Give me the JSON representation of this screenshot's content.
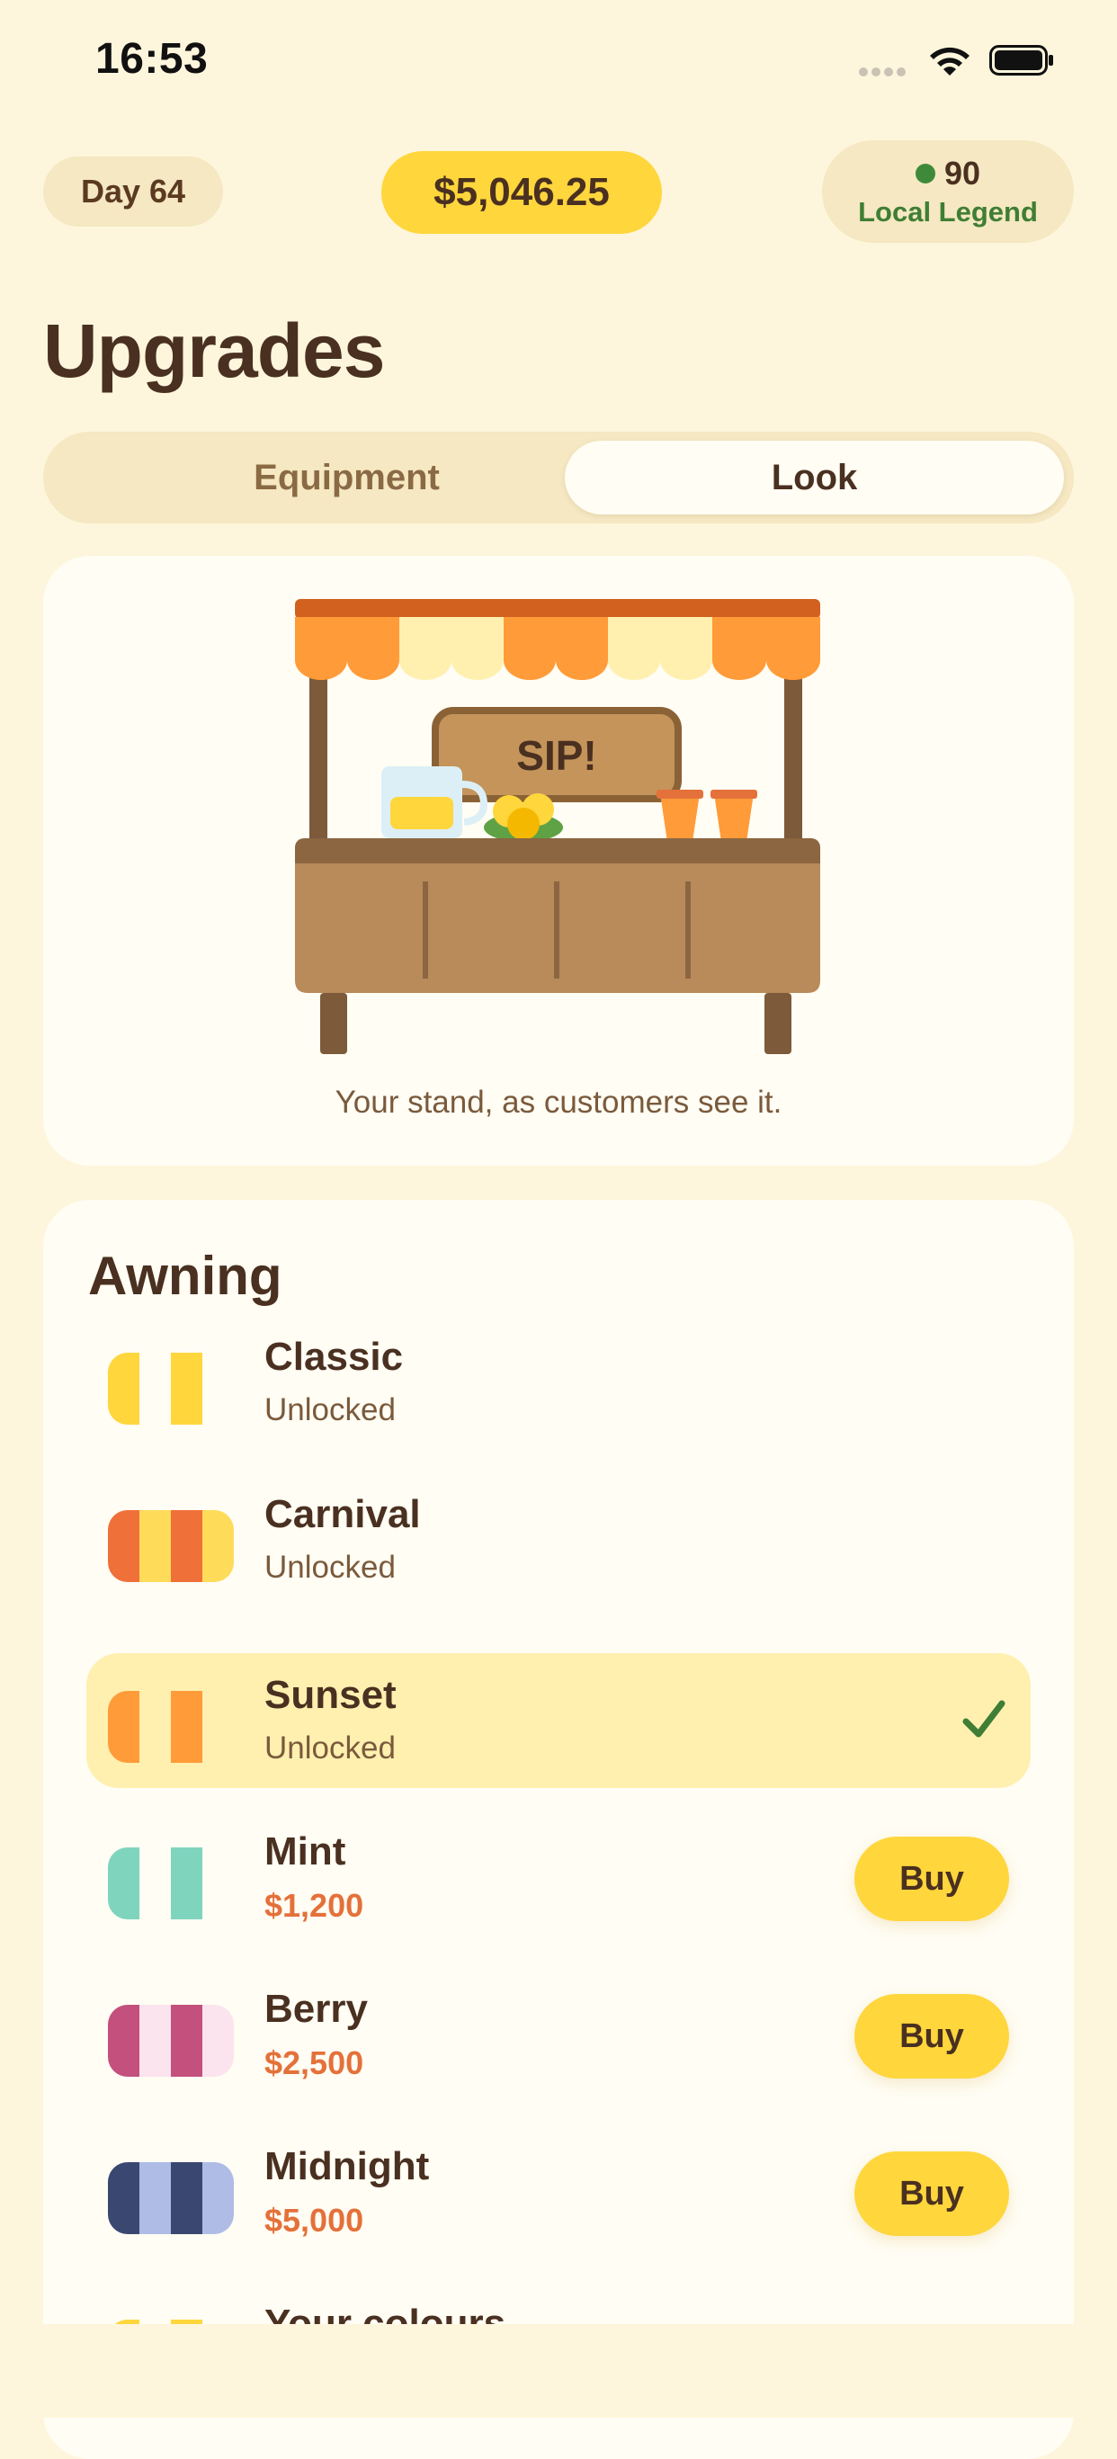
{
  "status_bar": {
    "time": "16:53"
  },
  "header": {
    "day": "Day 64",
    "balance": "$5,046.25",
    "reputation_score": "90",
    "reputation_label": "Local Legend",
    "reputation_color": "#3F8A3A"
  },
  "page_title": "Upgrades",
  "tabs": [
    {
      "label": "Equipment",
      "selected": false
    },
    {
      "label": "Look",
      "selected": true
    }
  ],
  "preview": {
    "sign_text": "SIP!",
    "caption": "Your stand, as customers see it."
  },
  "awning": {
    "section_title": "Awning",
    "items": [
      {
        "name": "Classic",
        "status": "Unlocked",
        "colors": [
          "#FFD63C",
          "#FFFDF4"
        ]
      },
      {
        "name": "Carnival",
        "status": "Unlocked",
        "colors": [
          "#F0703A",
          "#FFDB5A"
        ]
      },
      {
        "name": "Sunset",
        "status": "Unlocked",
        "selected": true,
        "colors": [
          "#FF9B38",
          "#FFF0B0"
        ]
      },
      {
        "name": "Mint",
        "price": "$1,200",
        "button": "Buy",
        "colors": [
          "#7FD4BE",
          "#FFFDF4"
        ]
      },
      {
        "name": "Berry",
        "price": "$2,500",
        "button": "Buy",
        "colors": [
          "#C4507E",
          "#FCE4EE"
        ]
      },
      {
        "name": "Midnight",
        "price": "$5,000",
        "button": "Buy",
        "colors": [
          "#3A4770",
          "#AEBCE6"
        ]
      },
      {
        "name": "Your colours",
        "colors": [
          "#FFD63C",
          "#FFFDF4"
        ]
      }
    ]
  }
}
